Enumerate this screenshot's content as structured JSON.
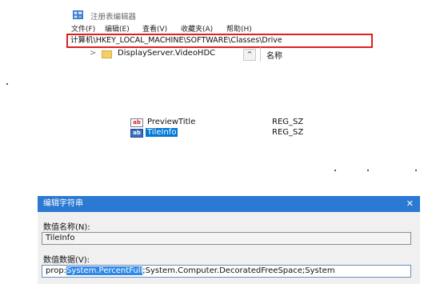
{
  "window": {
    "icon": "registry-editor-icon",
    "title": "注册表编辑器",
    "menu": [
      "文件(F)",
      "编辑(E)",
      "查看(V)",
      "收藏夹(A)",
      "帮助(H)"
    ],
    "address": "计算机\\HKEY_LOCAL_MACHINE\\SOFTWARE\\Classes\\Drive",
    "tree": {
      "expander": "chevron-right-icon",
      "folder_icon": "folder-icon",
      "label": "DisplayServer.VideoHDC",
      "scroll_glyph": "^"
    },
    "column_header": "名称"
  },
  "values": [
    {
      "icon": "string-value-icon",
      "icon_text": "ab",
      "name": "PreviewTitle",
      "type": "REG_SZ",
      "selected": false
    },
    {
      "icon": "binary-value-icon",
      "icon_text": "ab",
      "name": "TileInfo",
      "type": "REG_SZ",
      "selected": true
    }
  ],
  "dialog": {
    "title": "编辑字符串",
    "close_glyph": "✕",
    "name_label": "数值名称(N):",
    "name_value": "TileInfo",
    "data_label": "数值数据(V):",
    "data_prefix": "prop:",
    "data_selected": "System.PercentFull",
    "data_rest": ";System.Computer.DecoratedFreeSpace;System"
  },
  "colors": {
    "address_border": "#e02020",
    "dialog_titlebar": "#2b79d3",
    "selection": "#0078d7"
  }
}
